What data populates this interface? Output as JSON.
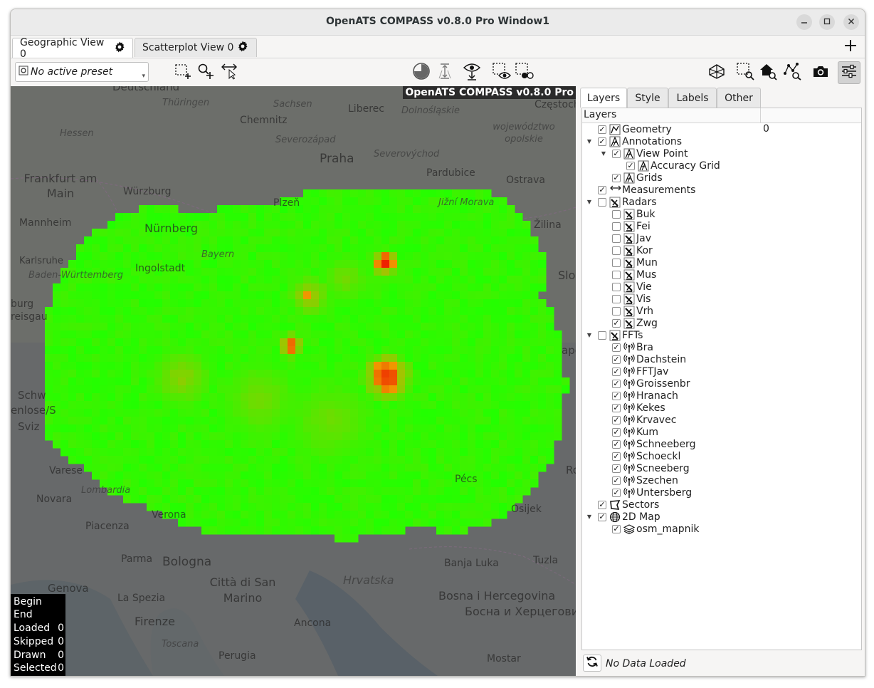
{
  "window": {
    "title": "OpenATS COMPASS v0.8.0 Pro Window1",
    "minimize_icon": "minimize-icon",
    "maximize_icon": "maximize-icon",
    "close_icon": "close-icon"
  },
  "view_tabs": [
    {
      "label": "Geographic View 0",
      "icon": "gear-icon",
      "active": true
    },
    {
      "label": "Scatterplot View 0",
      "icon": "gear-icon",
      "active": false
    }
  ],
  "add_view_icon": "plus-icon",
  "toolbar": {
    "preset_value": "No active preset",
    "left_tools": [
      "select-rect-icon",
      "select-point-add-icon",
      "measure-icon"
    ],
    "center_tools": [
      "time-filter-icon",
      "height-filter-icon",
      "eye-download-icon",
      "select-eye-icon",
      "select-dots-icon"
    ],
    "right_tools": [
      "3d-view-icon",
      "zoom-rect-icon",
      "home-zoom-icon",
      "zoom-data-icon",
      "camera-icon",
      "settings-sliders-icon"
    ]
  },
  "map": {
    "banner": "OpenATS COMPASS v0.8.0 Pro",
    "place_labels": [
      "Deutschland",
      "Thüringen",
      "Sachsen",
      "Liberec",
      "Dolnośląskie",
      "Częstochowa",
      "Hessen",
      "Chemnitz",
      "Severozápad",
      "województwo opolskie",
      "Frankfurt am Main",
      "Praha",
      "Severovýchod",
      "Pardubice",
      "Ostrava",
      "Würzburg",
      "Plzeň",
      "Jižní Morava",
      "Mannheim",
      "Nürnberg",
      "Žilina",
      "Karlsruhe",
      "Ingolstadt",
      "Bayern",
      "Baden-Württemberg",
      "Slo",
      "burg",
      "reisgau",
      "Schw",
      "enlose/S",
      "Sviz",
      "Varese",
      "Novara",
      "Lombardia",
      "Verona",
      "Osijek",
      "Piacenza",
      "Parma",
      "Bologna",
      "Banja Luka",
      "Tuzla",
      "Genova",
      "La Spezia",
      "Città di San Marino",
      "Hrvatska",
      "Bosna i Hercegovina",
      "Босна и Херцеговина",
      "Firenze",
      "Ancona",
      "Toscana",
      "Perugia",
      "Mostar",
      "Pécs",
      "ape",
      "Ro"
    ],
    "stats": [
      {
        "label": "Begin",
        "value": ""
      },
      {
        "label": "End",
        "value": ""
      },
      {
        "label": "Loaded",
        "value": "0"
      },
      {
        "label": "Skipped",
        "value": "0"
      },
      {
        "label": "Drawn",
        "value": "0"
      },
      {
        "label": "Selected",
        "value": "0"
      }
    ],
    "grid_colors": {
      "low": "#22ff00",
      "mid": "#f0a000",
      "high": "#ee2000"
    }
  },
  "panel": {
    "tabs": [
      {
        "label": "Layers",
        "active": true
      },
      {
        "label": "Style",
        "active": false
      },
      {
        "label": "Labels",
        "active": false
      },
      {
        "label": "Other",
        "active": false
      }
    ],
    "tree_header": "Layers",
    "tree": [
      {
        "depth": 0,
        "expander": "",
        "checked": true,
        "icon": "geometry-icon",
        "label": "Geometry",
        "value": "0"
      },
      {
        "depth": 0,
        "expander": "▼",
        "checked": true,
        "icon": "annotation-icon",
        "label": "Annotations",
        "value": ""
      },
      {
        "depth": 1,
        "expander": "▼",
        "checked": true,
        "icon": "annotation-icon",
        "label": "View Point",
        "value": ""
      },
      {
        "depth": 2,
        "expander": "",
        "checked": true,
        "icon": "annotation-icon",
        "label": "Accuracy Grid",
        "value": ""
      },
      {
        "depth": 1,
        "expander": "",
        "checked": true,
        "icon": "annotation-icon",
        "label": "Grids",
        "value": ""
      },
      {
        "depth": 0,
        "expander": "",
        "checked": true,
        "icon": "measure-icon",
        "label": "Measurements",
        "value": ""
      },
      {
        "depth": 0,
        "expander": "▼",
        "checked": false,
        "icon": "radar-icon",
        "label": "Radars",
        "value": ""
      },
      {
        "depth": 1,
        "expander": "",
        "checked": false,
        "icon": "radar-icon",
        "label": "Buk",
        "value": ""
      },
      {
        "depth": 1,
        "expander": "",
        "checked": false,
        "icon": "radar-icon",
        "label": "Fei",
        "value": ""
      },
      {
        "depth": 1,
        "expander": "",
        "checked": false,
        "icon": "radar-icon",
        "label": "Jav",
        "value": ""
      },
      {
        "depth": 1,
        "expander": "",
        "checked": false,
        "icon": "radar-icon",
        "label": "Kor",
        "value": ""
      },
      {
        "depth": 1,
        "expander": "",
        "checked": false,
        "icon": "radar-icon",
        "label": "Mun",
        "value": ""
      },
      {
        "depth": 1,
        "expander": "",
        "checked": false,
        "icon": "radar-icon",
        "label": "Mus",
        "value": ""
      },
      {
        "depth": 1,
        "expander": "",
        "checked": false,
        "icon": "radar-icon",
        "label": "Vie",
        "value": ""
      },
      {
        "depth": 1,
        "expander": "",
        "checked": false,
        "icon": "radar-icon",
        "label": "Vis",
        "value": ""
      },
      {
        "depth": 1,
        "expander": "",
        "checked": false,
        "icon": "radar-icon",
        "label": "Vrh",
        "value": ""
      },
      {
        "depth": 1,
        "expander": "",
        "checked": true,
        "icon": "radar-icon",
        "label": "Zwg",
        "value": ""
      },
      {
        "depth": 0,
        "expander": "▼",
        "checked": false,
        "icon": "radar-icon",
        "label": "FFTs",
        "value": ""
      },
      {
        "depth": 1,
        "expander": "",
        "checked": true,
        "icon": "antenna-icon",
        "label": "Bra",
        "value": ""
      },
      {
        "depth": 1,
        "expander": "",
        "checked": true,
        "icon": "antenna-icon",
        "label": "Dachstein",
        "value": ""
      },
      {
        "depth": 1,
        "expander": "",
        "checked": true,
        "icon": "antenna-icon",
        "label": "FFTJav",
        "value": ""
      },
      {
        "depth": 1,
        "expander": "",
        "checked": true,
        "icon": "antenna-icon",
        "label": "Groissenbr",
        "value": ""
      },
      {
        "depth": 1,
        "expander": "",
        "checked": true,
        "icon": "antenna-icon",
        "label": "Hranach",
        "value": ""
      },
      {
        "depth": 1,
        "expander": "",
        "checked": true,
        "icon": "antenna-icon",
        "label": "Kekes",
        "value": ""
      },
      {
        "depth": 1,
        "expander": "",
        "checked": true,
        "icon": "antenna-icon",
        "label": "Krvavec",
        "value": ""
      },
      {
        "depth": 1,
        "expander": "",
        "checked": true,
        "icon": "antenna-icon",
        "label": "Kum",
        "value": ""
      },
      {
        "depth": 1,
        "expander": "",
        "checked": true,
        "icon": "antenna-icon",
        "label": "Schneeberg",
        "value": ""
      },
      {
        "depth": 1,
        "expander": "",
        "checked": true,
        "icon": "antenna-icon",
        "label": "Schoeckl",
        "value": ""
      },
      {
        "depth": 1,
        "expander": "",
        "checked": true,
        "icon": "antenna-icon",
        "label": "Scneeberg",
        "value": ""
      },
      {
        "depth": 1,
        "expander": "",
        "checked": true,
        "icon": "antenna-icon",
        "label": "Szechen",
        "value": ""
      },
      {
        "depth": 1,
        "expander": "",
        "checked": true,
        "icon": "antenna-icon",
        "label": "Untersberg",
        "value": ""
      },
      {
        "depth": 0,
        "expander": "",
        "checked": true,
        "icon": "sector-icon",
        "label": "Sectors",
        "value": ""
      },
      {
        "depth": 0,
        "expander": "▼",
        "checked": true,
        "icon": "globe-icon",
        "label": "2D Map",
        "value": ""
      },
      {
        "depth": 1,
        "expander": "",
        "checked": true,
        "icon": "layers-icon",
        "label": "osm_mapnik",
        "value": ""
      }
    ],
    "status_text": "No Data Loaded",
    "refresh_icon": "refresh-icon"
  }
}
